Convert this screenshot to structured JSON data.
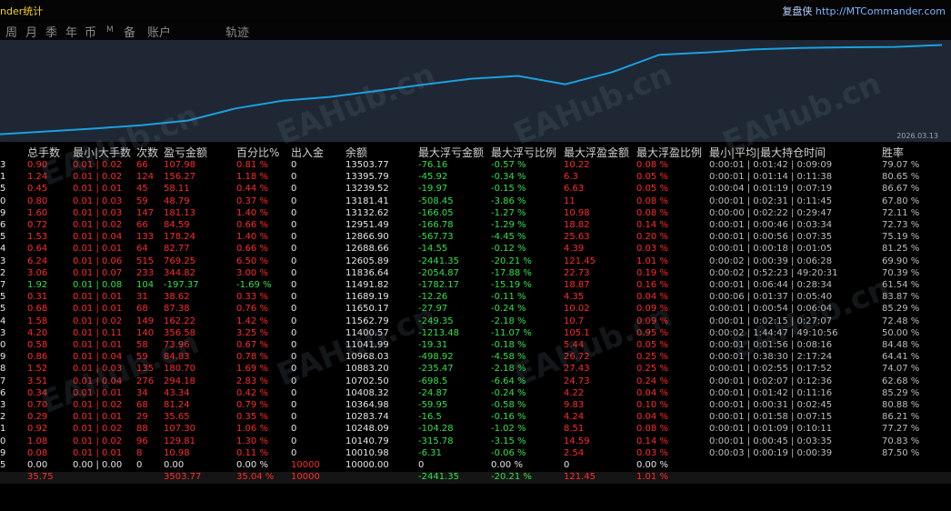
{
  "title": "nder统计",
  "brand": {
    "cn": "复盘侠",
    "url": "http://MTCommander.com"
  },
  "tabs": [
    "周",
    "月",
    "季",
    "年",
    "币",
    "M",
    "备",
    "账户",
    "轨迹"
  ],
  "chart": {
    "date_label": "2026.03.13",
    "line_color": "#1aa0e0",
    "bg_color": "#1e2733"
  },
  "chart_data": {
    "type": "line",
    "x": [
      0,
      5,
      10,
      15,
      20,
      25,
      30,
      35,
      40,
      45,
      50,
      55,
      60,
      65,
      70,
      75,
      80,
      85,
      90,
      95,
      100
    ],
    "values": [
      10000,
      10111,
      10221,
      10352,
      10540,
      11010,
      11315,
      11466,
      11700,
      11950,
      12180,
      12290,
      11960,
      12440,
      13120,
      13210,
      13330,
      13390,
      13415,
      13430,
      13503
    ],
    "ylim": [
      9700,
      13700
    ],
    "grid": false
  },
  "watermark": "EAHub.cn",
  "columns": [
    "总手数",
    "最小|大手数",
    "次数",
    "盈亏金额",
    "百分比%",
    "出入金",
    "余额",
    "最大浮亏金额",
    "最大浮亏比例",
    "最大浮盈金额",
    "最大浮盈比例",
    "最小|平均|最大持仓时间",
    "胜率"
  ],
  "rows": [
    [
      "3",
      "0.90",
      "0.01 | 0.02",
      "66",
      "107.98",
      "0.81 %",
      "0",
      "13503.77",
      "-76.16",
      "-0.57 %",
      "10.22",
      "0.08 %",
      "0:00:01 | 0:01:42 | 0:09:09",
      "79.07 %"
    ],
    [
      "1",
      "1.24",
      "0.01 | 0.02",
      "124",
      "156.27",
      "1.18 %",
      "0",
      "13395.79",
      "-45.92",
      "-0.34 %",
      "6.3",
      "0.05 %",
      "0:00:01 | 0:01:14 | 0:11:38",
      "80.65 %"
    ],
    [
      "5",
      "0.45",
      "0.01 | 0.01",
      "45",
      "58.11",
      "0.44 %",
      "0",
      "13239.52",
      "-19.97",
      "-0.15 %",
      "6.63",
      "0.05 %",
      "0:00:04 | 0:01:19 | 0:07:19",
      "86.67 %"
    ],
    [
      "0",
      "0.80",
      "0.01 | 0.03",
      "59",
      "48.79",
      "0.37 %",
      "0",
      "13181.41",
      "-508.45",
      "-3.86 %",
      "11",
      "0.08 %",
      "0:00:01 | 0:02:31 | 0:11:45",
      "67.80 %"
    ],
    [
      "9",
      "1.60",
      "0.01 | 0.03",
      "147",
      "181.13",
      "1.40 %",
      "0",
      "13132.62",
      "-166.05",
      "-1.27 %",
      "10.98",
      "0.08 %",
      "0:00:00 | 0:02:22 | 0:29:47",
      "72.11 %"
    ],
    [
      "6",
      "0.72",
      "0.01 | 0.02",
      "66",
      "84.59",
      "0.66 %",
      "0",
      "12951.49",
      "-166.78",
      "-1.29 %",
      "18.82",
      "0.14 %",
      "0:00:01 | 0:00:46 | 0:03:34",
      "72.73 %"
    ],
    [
      "5",
      "1.53",
      "0.01 | 0.04",
      "133",
      "178.24",
      "1.40 %",
      "0",
      "12866.90",
      "-567.73",
      "-4.45 %",
      "25.63",
      "0.20 %",
      "0:00:01 | 0:00:56 | 0:07:35",
      "75.19 %"
    ],
    [
      "4",
      "0.64",
      "0.01 | 0.01",
      "64",
      "82.77",
      "0.66 %",
      "0",
      "12688.66",
      "-14.55",
      "-0.12 %",
      "4.39",
      "0.03 %",
      "0:00:01 | 0:00:18 | 0:01:05",
      "81.25 %"
    ],
    [
      "3",
      "6.24",
      "0.01 | 0.06",
      "515",
      "769.25",
      "6.50 %",
      "0",
      "12605.89",
      "-2441.35",
      "-20.21 %",
      "121.45",
      "1.01 %",
      "0:00:02 | 0:00:39 | 0:06:28",
      "69.90 %"
    ],
    [
      "2",
      "3.06",
      "0.01 | 0.07",
      "233",
      "344.82",
      "3.00 %",
      "0",
      "11836.64",
      "-2054.87",
      "-17.88 %",
      "22.73",
      "0.19 %",
      "0:00:02 | 0:52:23 | 49:20:31",
      "70.39 %"
    ],
    [
      "7",
      "1.92",
      "0.01 | 0.08",
      "104",
      "-197.37",
      "-1.69 %",
      "0",
      "11491.82",
      "-1782.17",
      "-15.19 %",
      "18.87",
      "0.16 %",
      "0:00:01 | 0:06:44 | 0:28:34",
      "61.54 %"
    ],
    [
      "5",
      "0.31",
      "0.01 | 0.01",
      "31",
      "38.62",
      "0.33 %",
      "0",
      "11689.19",
      "-12.26",
      "-0.11 %",
      "4.35",
      "0.04 %",
      "0:00:06 | 0:01:37 | 0:05:40",
      "83.87 %"
    ],
    [
      "5",
      "0.68",
      "0.01 | 0.01",
      "68",
      "87.38",
      "0.76 %",
      "0",
      "11650.17",
      "-27.97",
      "-0.24 %",
      "10.02",
      "0.09 %",
      "0:00:01 | 0:00:54 | 0:06:04",
      "85.29 %"
    ],
    [
      "4",
      "1.58",
      "0.01 | 0.02",
      "149",
      "162.22",
      "1.42 %",
      "0",
      "11562.79",
      "-249.35",
      "-2.18 %",
      "10.7",
      "0.09 %",
      "0:00:01 | 0:02:15 | 0:27:07",
      "72.48 %"
    ],
    [
      "3",
      "4.20",
      "0.01 | 0.11",
      "140",
      "356.58",
      "3.25 %",
      "0",
      "11400.57",
      "-1213.48",
      "-11.07 %",
      "105.1",
      "0.95 %",
      "0:00:02 | 1:44:47 | 49:10:56",
      "50.00 %"
    ],
    [
      "0",
      "0.58",
      "0.01 | 0.01",
      "58",
      "73.96",
      "0.67 %",
      "0",
      "11041.99",
      "-19.31",
      "-0.18 %",
      "5.44",
      "0.05 %",
      "0:00:01 | 0:01:56 | 0:08:16",
      "84.48 %"
    ],
    [
      "9",
      "0.86",
      "0.01 | 0.04",
      "59",
      "84.83",
      "0.78 %",
      "0",
      "10968.03",
      "-498.92",
      "-4.58 %",
      "26.72",
      "0.25 %",
      "0:00:01 | 0:38:30 | 2:17:24",
      "64.41 %"
    ],
    [
      "8",
      "1.52",
      "0.01 | 0.03",
      "135",
      "180.70",
      "1.69 %",
      "0",
      "10883.20",
      "-235.47",
      "-2.18 %",
      "27.43",
      "0.25 %",
      "0:00:01 | 0:02:55 | 0:17:52",
      "74.07 %"
    ],
    [
      "7",
      "3.51",
      "0.01 | 0.04",
      "276",
      "294.18",
      "2.83 %",
      "0",
      "10702.50",
      "-698.5",
      "-6.64 %",
      "24.73",
      "0.24 %",
      "0:00:01 | 0:02:07 | 0:12:36",
      "62.68 %"
    ],
    [
      "6",
      "0.34",
      "0.01 | 0.01",
      "34",
      "43.34",
      "0.42 %",
      "0",
      "10408.32",
      "-24.87",
      "-0.24 %",
      "4.22",
      "0.04 %",
      "0:00:01 | 0:01:42 | 0:11:16",
      "85.29 %"
    ],
    [
      "3",
      "0.70",
      "0.01 | 0.02",
      "68",
      "81.24",
      "0.79 %",
      "0",
      "10364.98",
      "-59.95",
      "-0.58 %",
      "9.83",
      "0.10 %",
      "0:00:01 | 0:00:31 | 0:02:45",
      "80.88 %"
    ],
    [
      "2",
      "0.29",
      "0.01 | 0.01",
      "29",
      "35.65",
      "0.35 %",
      "0",
      "10283.74",
      "-16.5",
      "-0.16 %",
      "4.24",
      "0.04 %",
      "0:00:01 | 0:01:58 | 0:07:15",
      "86.21 %"
    ],
    [
      "1",
      "0.92",
      "0.01 | 0.02",
      "88",
      "107.30",
      "1.06 %",
      "0",
      "10248.09",
      "-104.28",
      "-1.02 %",
      "8.51",
      "0.08 %",
      "0:00:01 | 0:01:09 | 0:10:11",
      "77.27 %"
    ],
    [
      "0",
      "1.08",
      "0.01 | 0.02",
      "96",
      "129.81",
      "1.30 %",
      "0",
      "10140.79",
      "-315.78",
      "-3.15 %",
      "14.59",
      "0.14 %",
      "0:00:01 | 0:00:45 | 0:03:35",
      "70.83 %"
    ],
    [
      "9",
      "0.08",
      "0.01 | 0.01",
      "8",
      "10.98",
      "0.11 %",
      "0",
      "10010.98",
      "-6.31",
      "-0.06 %",
      "2.54",
      "0.03 %",
      "0:00:03 | 0:00:19 | 0:00:39",
      "87.50 %"
    ],
    [
      "5",
      "0.00",
      "0.00 | 0.00",
      "0",
      "0.00",
      "0.00 %",
      "10000",
      "10000.00",
      "0",
      "0.00 %",
      "0",
      "0.00 %",
      "",
      ""
    ]
  ],
  "totals": [
    "35.75",
    "3503.77",
    "35.04 %",
    "10000",
    "-2441.35",
    "-20.21 %",
    "121.45",
    "1.01 %"
  ]
}
